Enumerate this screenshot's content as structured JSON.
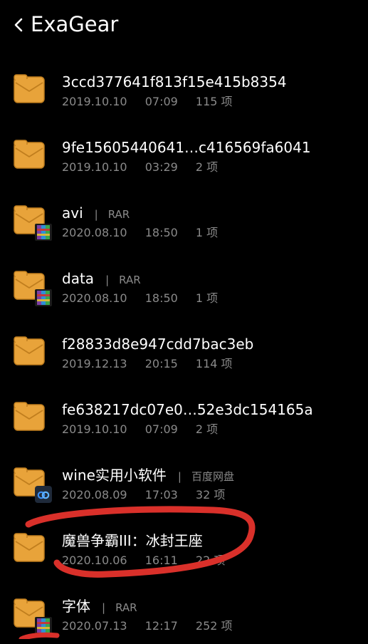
{
  "header": {
    "title": "ExaGear"
  },
  "items": [
    {
      "name": "3ccd377641f813f15e415b8354",
      "source": "",
      "date": "2019.10.10",
      "time": "07:09",
      "count": "115 项",
      "badge": ""
    },
    {
      "name": "9fe15605440641…c416569fa6041",
      "source": "",
      "date": "2019.10.10",
      "time": "03:29",
      "count": "2 项",
      "badge": ""
    },
    {
      "name": "avi",
      "source": "RAR",
      "date": "2020.08.10",
      "time": "18:50",
      "count": "1 项",
      "badge": "rar-icon"
    },
    {
      "name": "data",
      "source": "RAR",
      "date": "2020.08.10",
      "time": "18:50",
      "count": "1 项",
      "badge": "rar-icon"
    },
    {
      "name": "f28833d8e947cdd7bac3eb",
      "source": "",
      "date": "2019.12.13",
      "time": "20:15",
      "count": "114 项",
      "badge": ""
    },
    {
      "name": "fe638217dc07e0…52e3dc154165a",
      "source": "",
      "date": "2019.10.10",
      "time": "07:09",
      "count": "2 项",
      "badge": ""
    },
    {
      "name": "wine实用小软件",
      "source": "百度网盘",
      "date": "2020.08.09",
      "time": "17:03",
      "count": "32 项",
      "badge": "baidu-netdisk-icon"
    },
    {
      "name": "魔兽争霸III：冰封王座",
      "source": "",
      "date": "2020.10.06",
      "time": "16:11",
      "count": "22 项",
      "badge": ""
    },
    {
      "name": "字体",
      "source": "RAR",
      "date": "2020.07.13",
      "time": "12:17",
      "count": "252 项",
      "badge": "rar-icon"
    }
  ],
  "colors": {
    "folder": "#E8A33A",
    "folder_dark": "#C07E1E",
    "annotation": "#D9302A",
    "meta": "#8A8A8A"
  }
}
